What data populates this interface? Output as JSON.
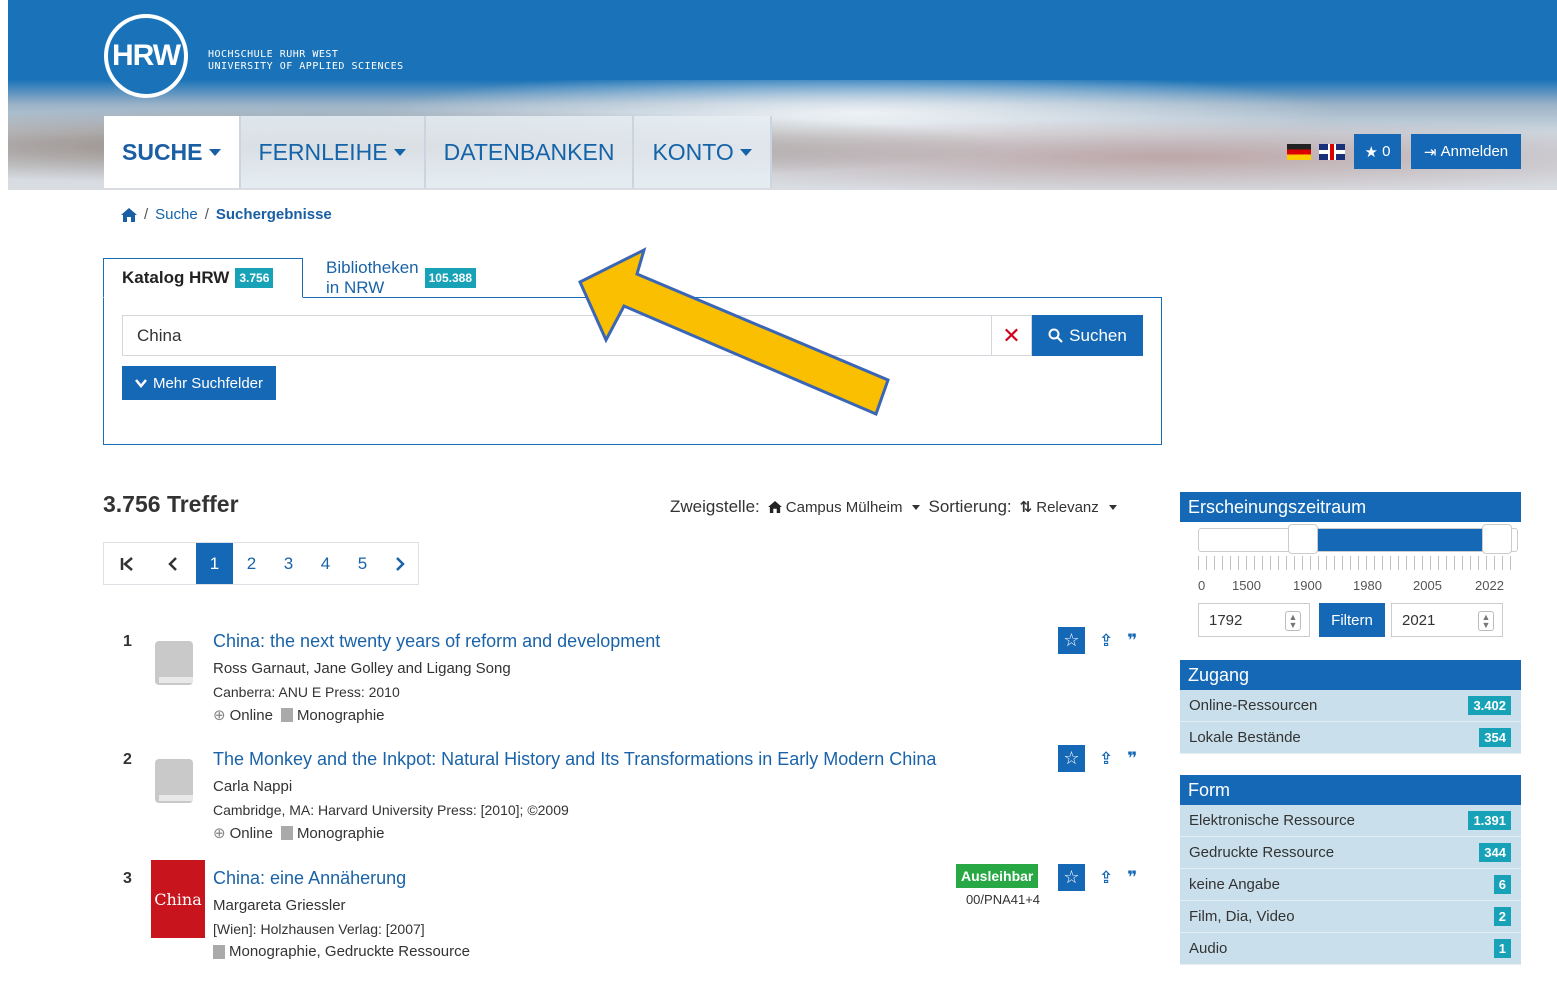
{
  "header": {
    "logo_text": "HRW",
    "org_name": "HOCHSCHULE RUHR WEST",
    "org_subtitle": "UNIVERSITY OF APPLIED SCIENCES",
    "nav": [
      "SUCHE",
      "FERNLEIHE",
      "DATENBANKEN",
      "KONTO"
    ],
    "favorites_count": "0",
    "login_label": "Anmelden"
  },
  "breadcrumb": {
    "search": "Suche",
    "current": "Suchergebnisse",
    "sep": "/"
  },
  "tabs": [
    {
      "label": "Katalog HRW",
      "count": "3.756"
    },
    {
      "label": "Bibliotheken in NRW",
      "count": "105.388"
    }
  ],
  "search": {
    "value": "China",
    "button": "Suchen",
    "more_fields": "Mehr Suchfelder"
  },
  "results_header": {
    "hits": "3.756 Treffer",
    "branch_label": "Zweigstelle:",
    "branch_value": "Campus Mülheim",
    "sort_label": "Sortierung:",
    "sort_value": "Relevanz"
  },
  "pager": [
    "1",
    "2",
    "3",
    "4",
    "5"
  ],
  "results": [
    {
      "num": "1",
      "title": "China: the next twenty years of reform and development",
      "authors": "Ross Garnaut, Jane Golley and Ligang Song",
      "publisher": "Canberra: ANU E Press: 2010",
      "online": "Online",
      "type": "Monographie"
    },
    {
      "num": "2",
      "title": "The Monkey and the Inkpot: Natural History and Its Transformations in Early Modern China",
      "authors": "Carla Nappi",
      "publisher": "Cambridge, MA: Harvard University Press: [2010]; ©2009",
      "online": "Online",
      "type": "Monographie"
    },
    {
      "num": "3",
      "title": "China: eine Annäherung",
      "authors": "Margareta Griessler",
      "publisher": "[Wien]: Holzhausen Verlag: [2007]",
      "type": "Monographie, Gedruckte Ressource",
      "availability": "Ausleihbar",
      "signature": "00/PNA41+4",
      "cover_text": "China"
    }
  ],
  "sidebar": {
    "period": {
      "title": "Erscheinungszeitraum",
      "ticks": [
        "0",
        "1500",
        "1900",
        "1980",
        "2005",
        "2022"
      ],
      "from": "1792",
      "to": "2021",
      "filter_button": "Filtern"
    },
    "access": {
      "title": "Zugang",
      "items": [
        {
          "label": "Online-Ressourcen",
          "count": "3.402"
        },
        {
          "label": "Lokale Bestände",
          "count": "354"
        }
      ]
    },
    "form": {
      "title": "Form",
      "items": [
        {
          "label": "Elektronische Ressource",
          "count": "1.391"
        },
        {
          "label": "Gedruckte Ressource",
          "count": "344"
        },
        {
          "label": "keine Angabe",
          "count": "6"
        },
        {
          "label": "Film, Dia, Video",
          "count": "2"
        },
        {
          "label": "Audio",
          "count": "1"
        }
      ]
    }
  },
  "colors": {
    "primary": "#1468b5",
    "badge": "#17a2b8",
    "available": "#28a745",
    "arrow": "#f9bf00",
    "facet_bg": "#c9e0ec"
  }
}
